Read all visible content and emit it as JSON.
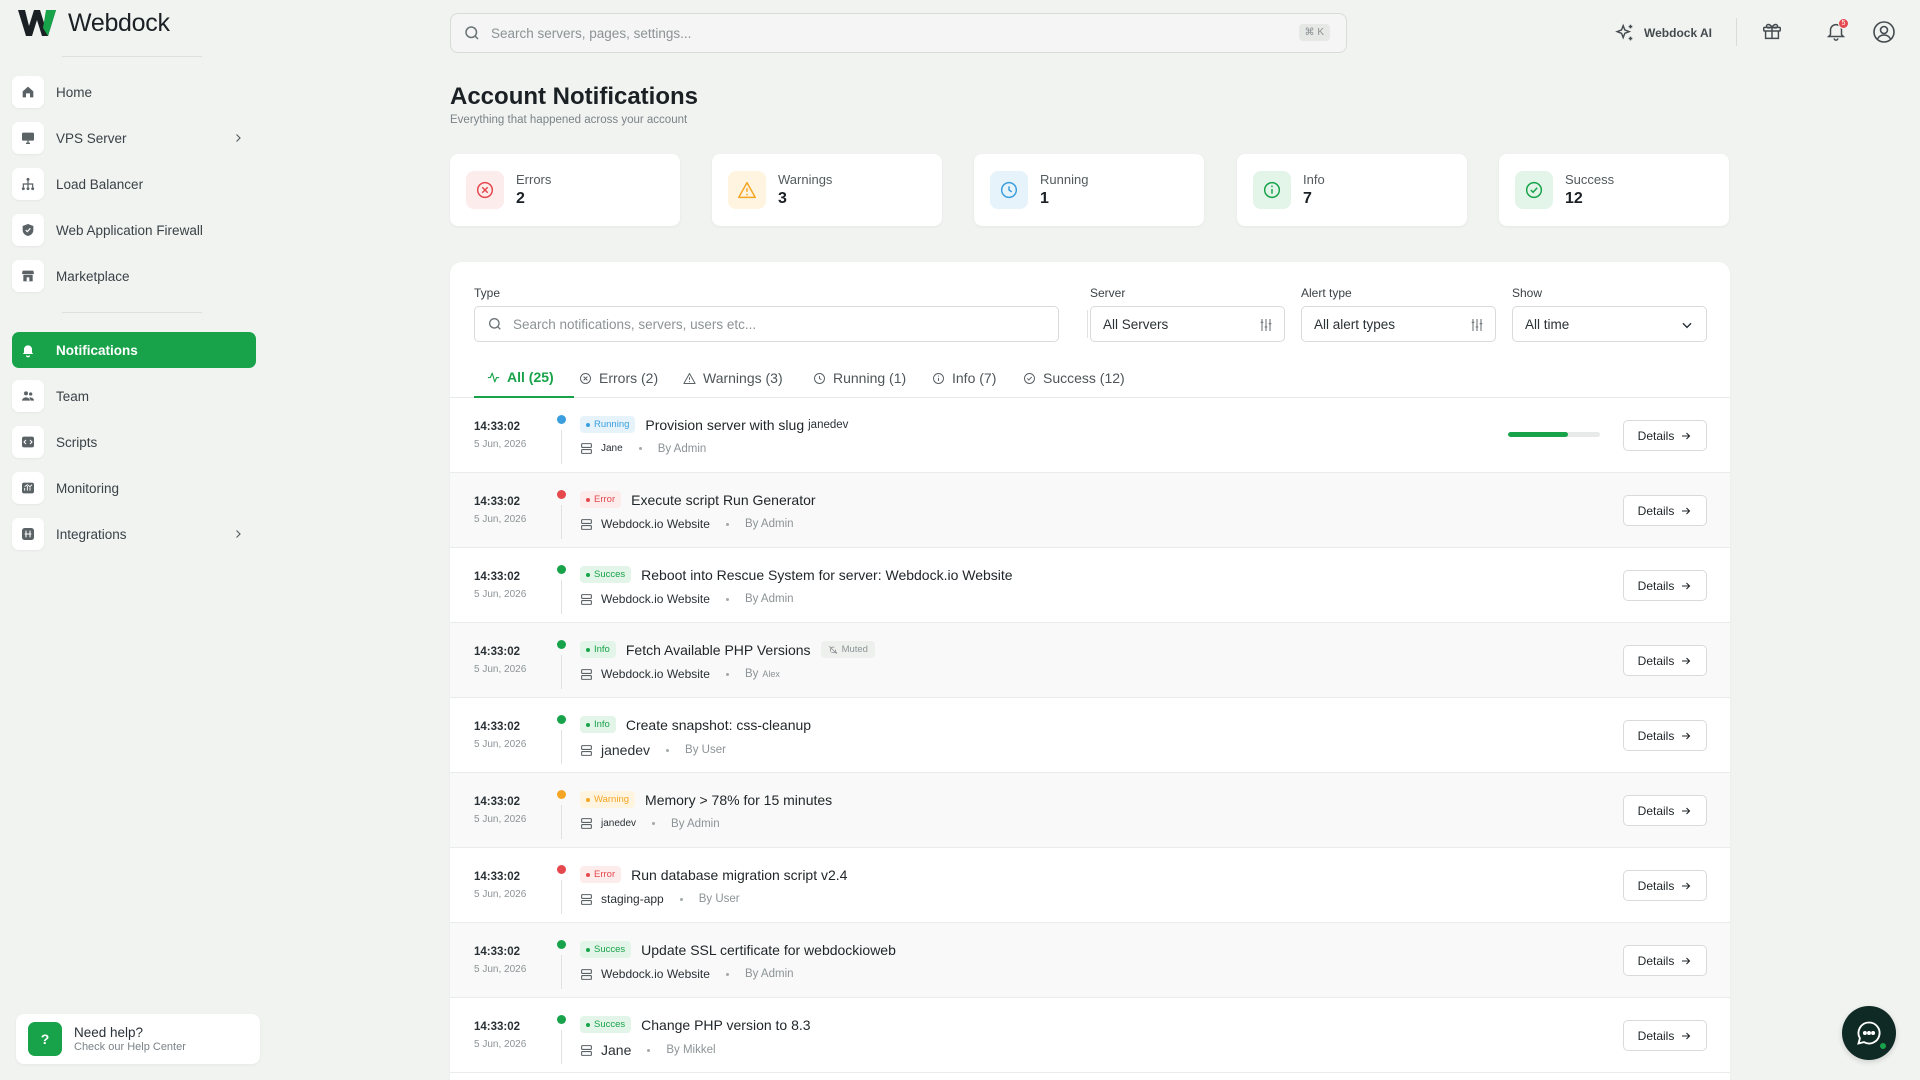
{
  "app": {
    "brand": "Webdock",
    "accent": "#18a34a"
  },
  "search": {
    "placeholder": "Search servers, pages, settings...",
    "shortcut": "⌘ K"
  },
  "topbar": {
    "ai_label": "Webdock AI",
    "notification_count": "5"
  },
  "sidebar": {
    "items": [
      {
        "label": "Home",
        "icon": "home-icon"
      },
      {
        "label": "VPS Server",
        "icon": "monitor-icon",
        "chevron": true
      },
      {
        "label": "Load Balancer",
        "icon": "network-icon"
      },
      {
        "label": "Web Application Firewall",
        "icon": "shield-icon"
      },
      {
        "label": "Marketplace",
        "icon": "store-icon"
      },
      {
        "label": "Notifications",
        "icon": "bell-icon",
        "active": true
      },
      {
        "label": "Team",
        "icon": "users-icon"
      },
      {
        "label": "Scripts",
        "icon": "code-icon"
      },
      {
        "label": "Monitoring",
        "icon": "chart-icon"
      },
      {
        "label": "Integrations",
        "icon": "integrations-icon",
        "chevron": true
      }
    ],
    "help": {
      "title": "Need help?",
      "subtitle": "Check our Help Center",
      "icon_text": "?"
    }
  },
  "header": {
    "title": "Account Notifications",
    "subtitle": "Everything that happened across your account"
  },
  "stats": [
    {
      "label": "Errors",
      "value": "2",
      "color": "#e5484d",
      "bg": "#fdecec",
      "icon": "x-circle-icon"
    },
    {
      "label": "Warnings",
      "value": "3",
      "color": "#f5a524",
      "bg": "#fff4e0",
      "icon": "warning-icon"
    },
    {
      "label": "Running",
      "value": "1",
      "color": "#3b9ede",
      "bg": "#e6f3fb",
      "icon": "clock-icon"
    },
    {
      "label": "Info",
      "value": "7",
      "color": "#18a34a",
      "bg": "#e3f4e8",
      "icon": "info-icon"
    },
    {
      "label": "Success",
      "value": "12",
      "color": "#18a34a",
      "bg": "#e3f4e8",
      "icon": "check-circle-icon"
    }
  ],
  "filters": {
    "type": {
      "label": "Type",
      "placeholder": "Search notifications, servers, users etc..."
    },
    "server": {
      "label": "Server",
      "value": "All Servers"
    },
    "alert_type": {
      "label": "Alert type",
      "value": "All alert types"
    },
    "show": {
      "label": "Show",
      "value": "All time"
    }
  },
  "tabs": [
    {
      "label": "All (25)",
      "icon": "activity-icon",
      "active": true
    },
    {
      "label": "Errors (2)",
      "icon": "x-circle-icon"
    },
    {
      "label": "Warnings (3)",
      "icon": "warning-icon"
    },
    {
      "label": "Running (1)",
      "icon": "clock-icon"
    },
    {
      "label": "Info (7)",
      "icon": "info-icon"
    },
    {
      "label": "Success (12)",
      "icon": "check-circle-icon"
    }
  ],
  "status_styles": {
    "Running": {
      "color": "#3b9ede",
      "bg": "#e6f3fb"
    },
    "Error": {
      "color": "#e5484d",
      "bg": "#fdecec"
    },
    "Succes": {
      "color": "#18a34a",
      "bg": "#e3f4e8"
    },
    "Info": {
      "color": "#18a34a",
      "bg": "#e3f4e8"
    },
    "Warning": {
      "color": "#f5a524",
      "bg": "#fff4e0"
    }
  },
  "notifications": [
    {
      "time": "14:33:02",
      "date": "5 Jun, 2026",
      "status": "Running",
      "title": "Provision server with slug",
      "slug": "janedev",
      "server": "Jane",
      "server_size": "small",
      "by": "By Admin",
      "progress": 0.65,
      "details": "Details"
    },
    {
      "time": "14:33:02",
      "date": "5 Jun, 2026",
      "status": "Error",
      "title": "Execute script Run Generator",
      "server": "Webdock.io Website",
      "server_size": "normal",
      "by": "By Admin",
      "details": "Details"
    },
    {
      "time": "14:33:02",
      "date": "5 Jun, 2026",
      "status": "Succes",
      "title": "Reboot into Rescue System for server: Webdock.io Website",
      "server": "Webdock.io Website",
      "server_size": "normal",
      "by": "By Admin",
      "details": "Details"
    },
    {
      "time": "14:33:02",
      "date": "5 Jun, 2026",
      "status": "Info",
      "title": "Fetch Available PHP Versions",
      "muted": "Muted",
      "server": "Webdock.io Website",
      "server_size": "normal",
      "by": "By",
      "by_name": "Alex",
      "details": "Details"
    },
    {
      "time": "14:33:02",
      "date": "5 Jun, 2026",
      "status": "Info",
      "title": "Create snapshot: css-cleanup",
      "server": "janedev",
      "server_size": "large",
      "by": "By User",
      "details": "Details"
    },
    {
      "time": "14:33:02",
      "date": "5 Jun, 2026",
      "status": "Warning",
      "title": "Memory > 78% for 15 minutes",
      "server": "janedev",
      "server_size": "small",
      "by": "By Admin",
      "details": "Details"
    },
    {
      "time": "14:33:02",
      "date": "5 Jun, 2026",
      "status": "Error",
      "title": "Run database migration script v2.4",
      "server": "staging-app",
      "server_size": "normal",
      "by": "By User",
      "details": "Details"
    },
    {
      "time": "14:33:02",
      "date": "5 Jun, 2026",
      "status": "Succes",
      "title": "Update SSL certificate for webdockioweb",
      "server": "Webdock.io Website",
      "server_size": "normal",
      "by": "By Admin",
      "details": "Details"
    },
    {
      "time": "14:33:02",
      "date": "5 Jun, 2026",
      "status": "Succes",
      "title": "Change PHP version to 8.3",
      "server": "Jane",
      "server_size": "large",
      "by": "By Mikkel",
      "details": "Details"
    }
  ]
}
